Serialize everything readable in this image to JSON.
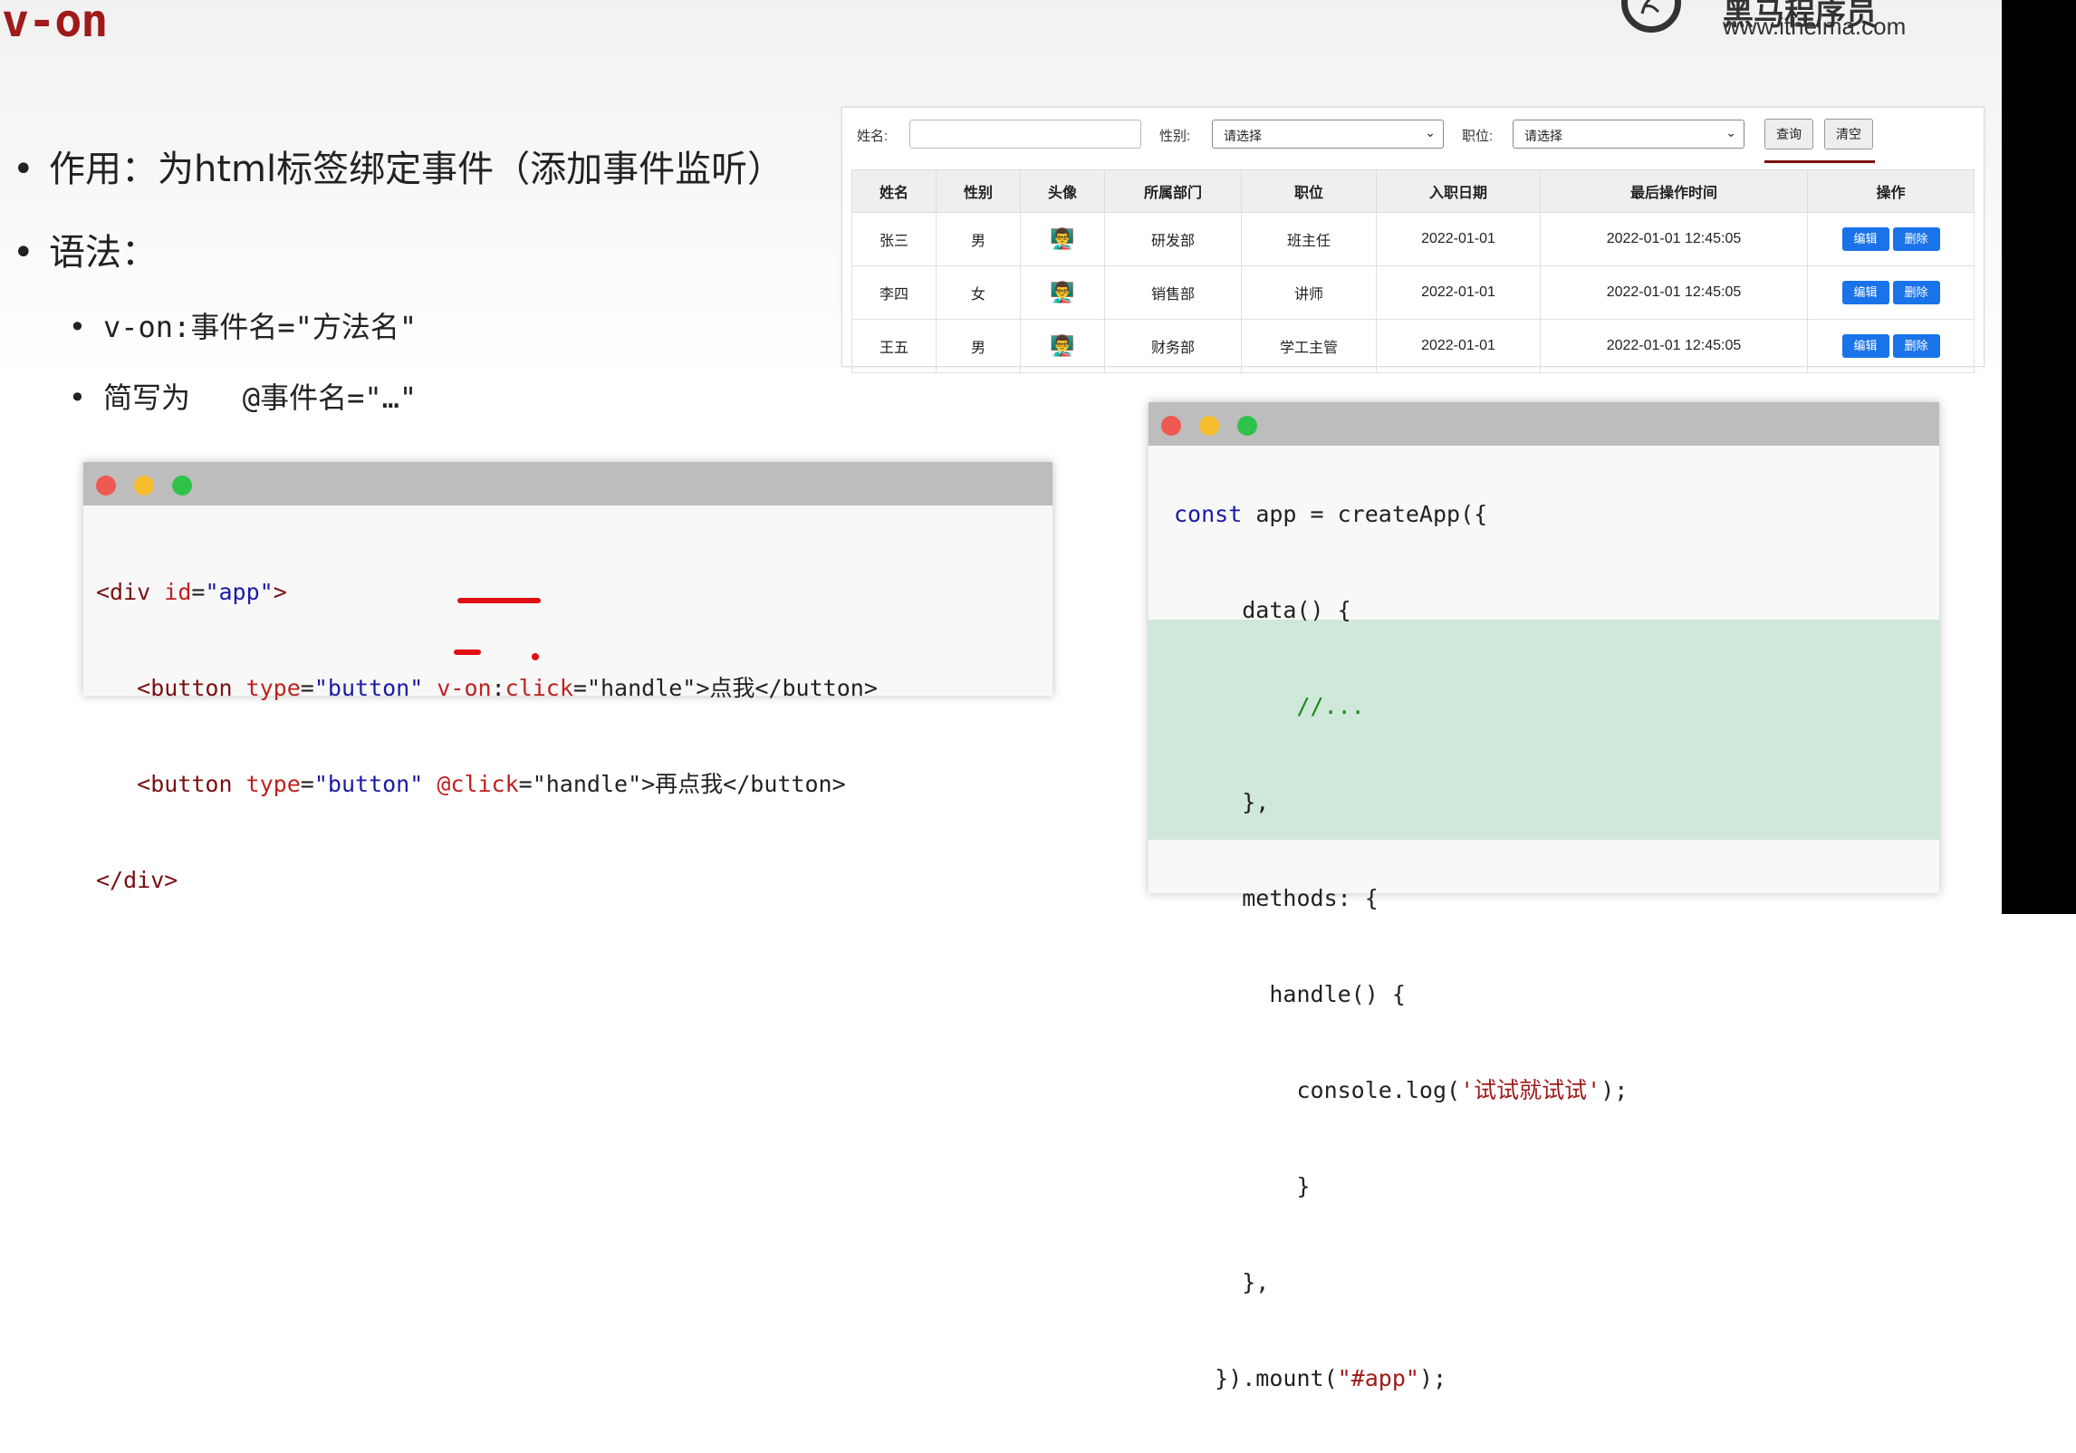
{
  "slide_title": "v-on",
  "logo": {
    "cn": "黑马程序员",
    "url": "www.itheima.com"
  },
  "bullets": {
    "purpose": "作用：为html标签绑定事件（添加事件监听）",
    "syntax": "语法：",
    "sub1": "v-on:事件名=\"方法名\"",
    "sub2": "简写为   @事件名=\"…\""
  },
  "filter": {
    "name_label": "姓名:",
    "gender_label": "性别:",
    "gender_value": "请选择",
    "position_label": "职位:",
    "position_value": "请选择",
    "query_button": "查询",
    "clear_button": "清空"
  },
  "table": {
    "headers": [
      "姓名",
      "性别",
      "头像",
      "所属部门",
      "职位",
      "入职日期",
      "最后操作时间",
      "操作"
    ],
    "rows": [
      {
        "name": "张三",
        "gender": "男",
        "dept": "研发部",
        "position": "班主任",
        "join": "2022-01-01",
        "last": "2022-01-01 12:45:05"
      },
      {
        "name": "李四",
        "gender": "女",
        "dept": "销售部",
        "position": "讲师",
        "join": "2022-01-01",
        "last": "2022-01-01 12:45:05"
      },
      {
        "name": "王五",
        "gender": "男",
        "dept": "财务部",
        "position": "学工主管",
        "join": "2022-01-01",
        "last": "2022-01-01 12:45:05"
      }
    ],
    "edit_label": "编辑",
    "delete_label": "删除"
  },
  "html_code": {
    "line1": {
      "open": "<div ",
      "attr": "id",
      "eq": "=",
      "val": "\"app\"",
      "close": ">"
    },
    "line2": {
      "indent": "   ",
      "open": "<button ",
      "attr": "type",
      "eq": "=",
      "val": "\"button\"",
      "sp": " ",
      "dir": "v-on",
      "colon": ":",
      "evt": "click",
      "rest": "=\"handle\">点我</button>"
    },
    "line3": {
      "indent": "   ",
      "open": "<button ",
      "attr": "type",
      "eq": "=",
      "val": "\"button\"",
      "sp": " ",
      "evt": "@click",
      "rest": "=\"handle\">再点我</button>"
    },
    "line4": "</div>"
  },
  "js_code": {
    "l1a": "const",
    "l1b": " app = createApp({",
    "l2": "     data() {",
    "l3": "         //...",
    "l4": "     },",
    "l5": "     methods: {",
    "l6": "       handle() {",
    "l7a": "         console.log(",
    "l7b": "'试试就试试'",
    "l7c": ");",
    "l8": "         }",
    "l9": "     },",
    "l10a": "   }).mount(",
    "l10b": "\"#app\"",
    "l10c": ");"
  }
}
